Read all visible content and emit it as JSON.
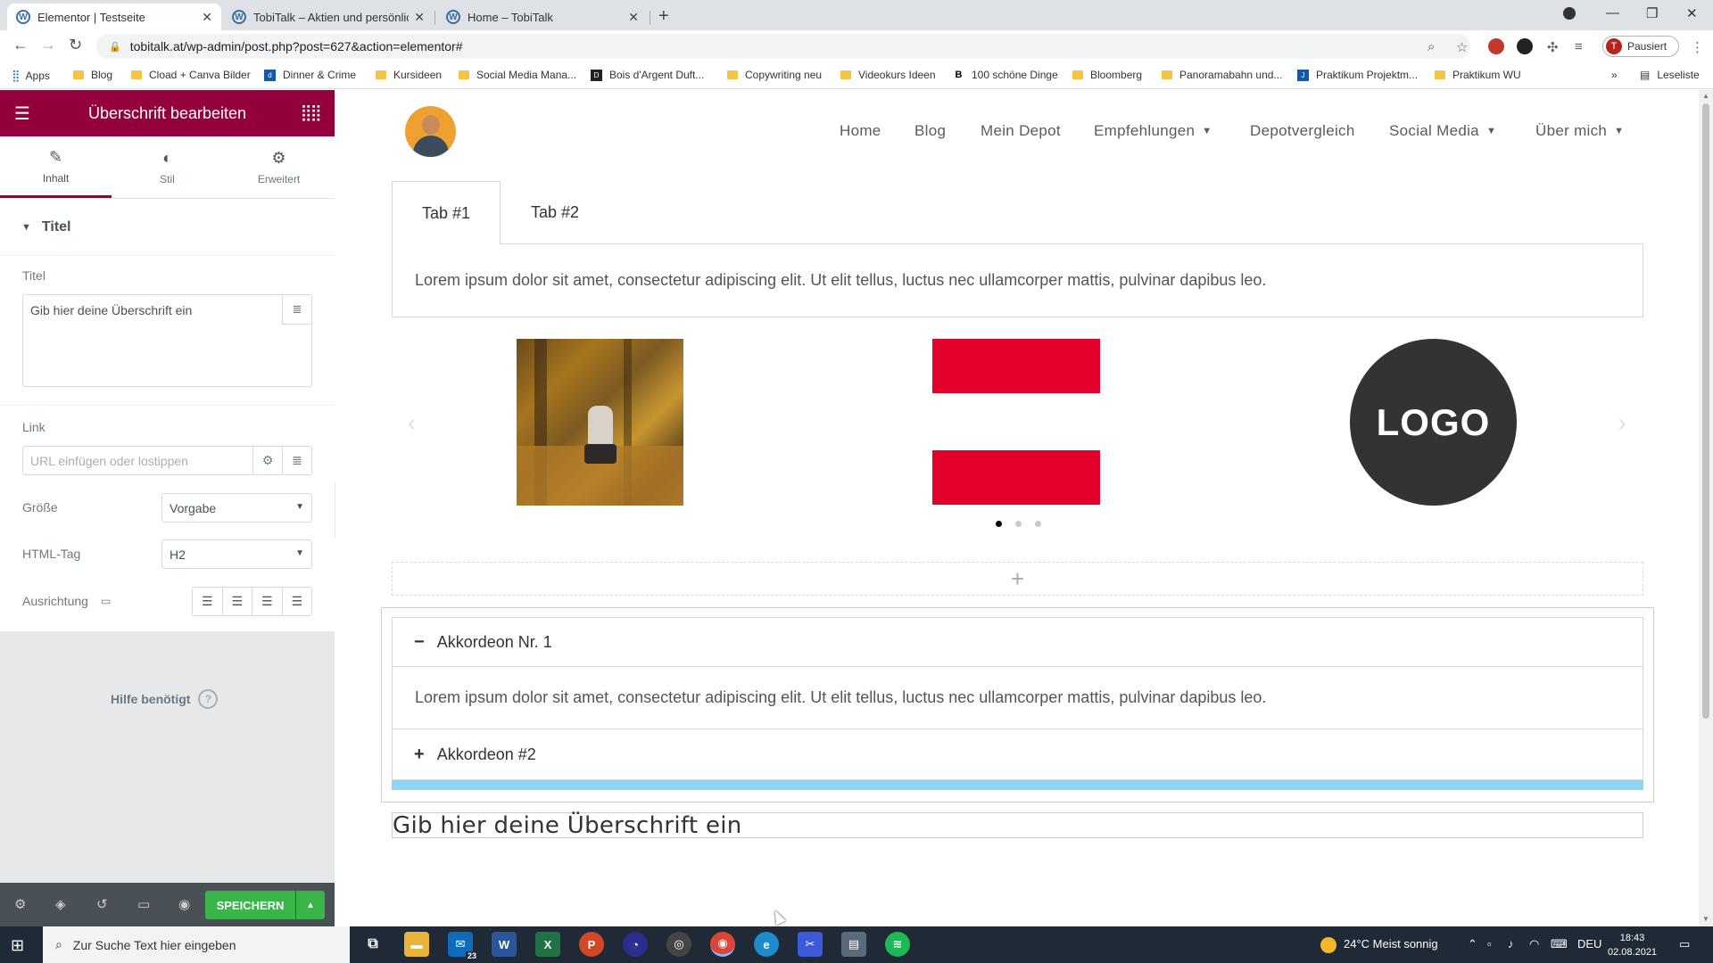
{
  "browser": {
    "tabs": [
      {
        "title": "Elementor | Testseite",
        "active": true
      },
      {
        "title": "TobiTalk – Aktien und persönlich",
        "active": false
      },
      {
        "title": "Home – TobiTalk",
        "active": false
      }
    ],
    "url": "tobitalk.at/wp-admin/post.php?post=627&action=elementor#",
    "profile_label": "Pausiert",
    "profile_initial": "T",
    "bookmarks": [
      {
        "label": "Apps",
        "icon": "apps-grid-icon"
      },
      {
        "label": "Blog",
        "icon": "folder-icon"
      },
      {
        "label": "Cload + Canva Bilder",
        "icon": "folder-icon"
      },
      {
        "label": "Dinner & Crime",
        "icon": "site-icon"
      },
      {
        "label": "Kursideen",
        "icon": "folder-icon"
      },
      {
        "label": "Social Media Mana...",
        "icon": "folder-icon"
      },
      {
        "label": "Bois d'Argent Duft...",
        "icon": "site-icon"
      },
      {
        "label": "Copywriting neu",
        "icon": "folder-icon"
      },
      {
        "label": "Videokurs Ideen",
        "icon": "folder-icon"
      },
      {
        "label": "100 schöne Dinge",
        "icon": "site-icon"
      },
      {
        "label": "Bloomberg",
        "icon": "folder-icon"
      },
      {
        "label": "Panoramabahn und...",
        "icon": "folder-icon"
      },
      {
        "label": "Praktikum Projektm...",
        "icon": "site-icon"
      },
      {
        "label": "Praktikum WU",
        "icon": "folder-icon"
      }
    ],
    "reading_list": "Leseliste"
  },
  "panel": {
    "header_title": "Überschrift bearbeiten",
    "tabs": [
      {
        "label": "Inhalt",
        "icon": "pencil-icon"
      },
      {
        "label": "Stil",
        "icon": "contrast-icon"
      },
      {
        "label": "Erweitert",
        "icon": "gear-icon"
      }
    ],
    "section_title": "Titel",
    "title_label": "Titel",
    "title_value": "Gib hier deine Überschrift ein",
    "link_label": "Link",
    "link_placeholder": "URL einfügen oder lostippen",
    "size_label": "Größe",
    "size_value": "Vorgabe",
    "html_tag_label": "HTML-Tag",
    "html_tag_value": "H2",
    "alignment_label": "Ausrichtung",
    "help_text": "Hilfe benötigt",
    "save_label": "SPEICHERN"
  },
  "site": {
    "nav": [
      {
        "label": "Home",
        "dropdown": false
      },
      {
        "label": "Blog",
        "dropdown": false
      },
      {
        "label": "Mein Depot",
        "dropdown": false
      },
      {
        "label": "Empfehlungen",
        "dropdown": true
      },
      {
        "label": "Depotvergleich",
        "dropdown": false
      },
      {
        "label": "Social Media",
        "dropdown": true
      },
      {
        "label": "Über mich",
        "dropdown": true
      }
    ],
    "tabs_widget": {
      "tabs": [
        "Tab #1",
        "Tab #2"
      ],
      "content": "Lorem ipsum dolor sit amet, consectetur adipiscing elit. Ut elit tellus, luctus nec ullamcorper mattis, pulvinar dapibus leo."
    },
    "carousel": {
      "logo_text": "LOGO",
      "active_dot": 0,
      "dot_count": 3
    },
    "accordion": {
      "items": [
        {
          "title": "Akkordeon Nr. 1",
          "open": true,
          "content": "Lorem ipsum dolor sit amet, consectetur adipiscing elit. Ut elit tellus, luctus nec ullamcorper mattis, pulvinar dapibus leo."
        },
        {
          "title": "Akkordeon #2",
          "open": false
        }
      ]
    },
    "heading": "Gib hier deine Überschrift ein"
  },
  "taskbar": {
    "search_placeholder": "Zur Suche Text hier eingeben",
    "mail_badge": "23",
    "weather": "24°C  Meist sonnig",
    "language": "DEU",
    "time": "18:43",
    "date": "02.08.2021"
  }
}
